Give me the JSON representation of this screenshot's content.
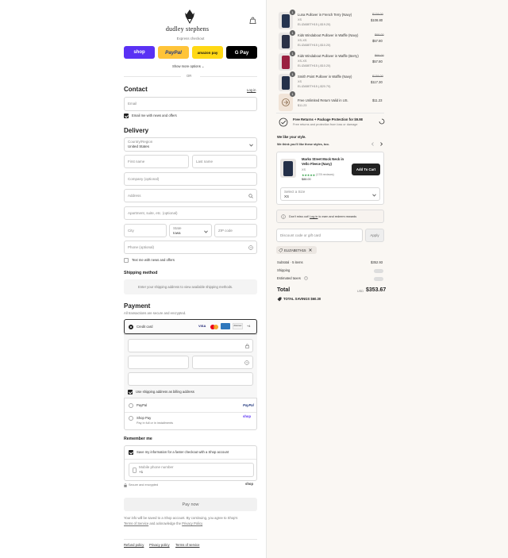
{
  "brand": "dudley stephens",
  "express_checkout": "Express checkout",
  "pay_buttons": [
    "shop",
    "PayPal",
    "amazon pay",
    "G Pay"
  ],
  "show_more": "Show more options ⌄",
  "or": "OR",
  "contact": {
    "title": "Contact",
    "login": "Log in",
    "email_placeholder": "Email",
    "news": "Email me with news and offers"
  },
  "delivery": {
    "title": "Delivery",
    "country_label": "Country/Region",
    "country": "United States",
    "first": "First name",
    "last": "Last name",
    "company": "Company (optional)",
    "address": "Address",
    "apt": "Apartment, suite, etc. (optional)",
    "city": "City",
    "state_label": "State",
    "state": "Iowa",
    "zip": "ZIP code",
    "phone": "Phone (optional)",
    "text_news": "Text me with news and offers"
  },
  "shipping_method": {
    "title": "Shipping method",
    "note": "Enter your shipping address to view available shipping methods."
  },
  "payment": {
    "title": "Payment",
    "subtitle": "All transactions are secure and encrypted.",
    "credit": "Credit card",
    "card_more": "+4",
    "billing": "Use shipping address as billing address",
    "paypal": "PayPal",
    "paypal_logo": "PayPal",
    "shop_pay": "Shop Pay",
    "shop_pay_sub": "Pay in full or in installments",
    "shop_logo": "shop"
  },
  "remember": {
    "title": "Remember me",
    "save": "Save my information for a faster checkout with a Shop account",
    "mobile_label": "Mobile phone number",
    "mobile": "+1",
    "secure": "Secure and encrypted",
    "shop": "shop"
  },
  "pay_now": "Pay now",
  "legal": {
    "text1": "Your info will be saved to a Shop account. By continuing, you agree to Shop's",
    "terms": "Terms of Service",
    "text2": "and acknowledge the",
    "privacy": "Privacy Policy"
  },
  "footer_links": [
    "Refund policy",
    "Privacy policy",
    "Terms of service"
  ],
  "items": [
    {
      "qty": "1",
      "name": "Luna Pullover in French Terry (Navy)",
      "variant": "XS",
      "code": "ELIZABETH15 (-$19.20)",
      "orig": "$128.00",
      "price": "$108.80"
    },
    {
      "qty": "1",
      "name": "Kids Windabout Pullover in Waffle (Navy)",
      "variant": "XS-XS",
      "code": "ELIZABETH15 (-$10.20)",
      "orig": "$68.00",
      "price": "$57.80"
    },
    {
      "qty": "1",
      "name": "Kids Windabout Pullover in Waffle (Berry)",
      "variant": "XS-XS",
      "code": "ELIZABETH15 (-$10.20)",
      "orig": "$68.00",
      "price": "$57.80"
    },
    {
      "qty": "1",
      "name": "Smith Point Pullover in Waffle (Navy)",
      "variant": "XS",
      "code": "ELIZABETH15 (-$20.70)",
      "orig": "$138.00",
      "price": "$117.30"
    },
    {
      "qty": "1",
      "name": "Free Unlimited Return Valid in US.",
      "variant": "$11.23",
      "code": "",
      "orig": "",
      "price": "$11.23"
    }
  ],
  "protection": {
    "title": "Free Returns + Package Protection for $9.98",
    "sub": "Free returns and protection from loss or damage"
  },
  "upsell": {
    "title": "We like your style.",
    "sub": "We think you'll like these styles, too.",
    "name": "Marks Street Mock Neck in Vello Fleece (Navy)",
    "variant": "XS",
    "rating": "★★★★★",
    "reviews": "(178 reviews)",
    "price": "$88.00",
    "cta": "Add To Cart",
    "size_label": "Select a Size",
    "size": "XS"
  },
  "rewards": {
    "text": "Don't miss out!",
    "login": "Log in",
    "rest": "to earn and redeem rewards"
  },
  "discount": {
    "placeholder": "Discount code or gift card",
    "apply": "Apply",
    "code": "ELIZABETH15"
  },
  "summary": {
    "subtotal": "Subtotal · 5 items",
    "subtotal_val": "$352.93",
    "shipping": "Shipping",
    "taxes": "Estimated taxes",
    "total": "Total",
    "currency": "USD",
    "total_val": "$353.67",
    "savings": "TOTAL SAVINGS",
    "savings_val": "$60.30"
  }
}
